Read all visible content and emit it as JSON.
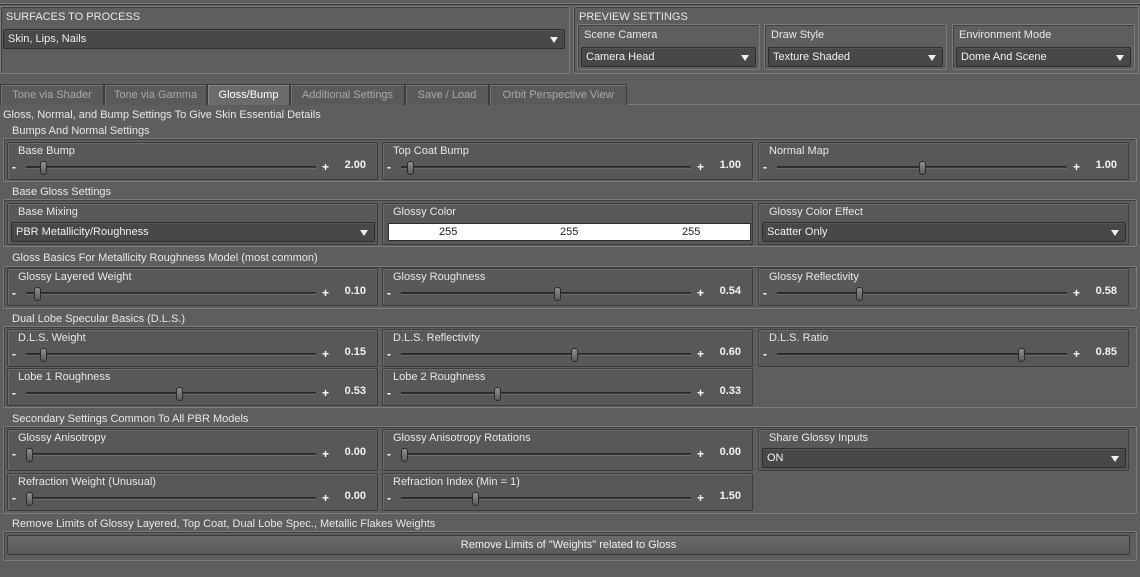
{
  "surfaces": {
    "title": "SURFACES TO PROCESS",
    "selected": "Skin, Lips, Nails"
  },
  "preview": {
    "title": "PREVIEW SETTINGS",
    "scene_camera": {
      "label": "Scene Camera",
      "value": "Camera Head"
    },
    "draw_style": {
      "label": "Draw Style",
      "value": "Texture Shaded"
    },
    "environment_mode": {
      "label": "Environment Mode",
      "value": "Dome And Scene"
    }
  },
  "tabs": [
    {
      "label": "Tone via Shader"
    },
    {
      "label": "Tone via Gamma"
    },
    {
      "label": "Gloss/Bump"
    },
    {
      "label": "Additional Settings"
    },
    {
      "label": "Save / Load"
    },
    {
      "label": "Orbit Perspective View"
    }
  ],
  "page_heading": "Gloss, Normal, and Bump Settings To Give Skin Essential Details",
  "bumps": {
    "title": "Bumps And Normal Settings",
    "base_bump": {
      "label": "Base Bump",
      "value": "2.00",
      "level": 0.05
    },
    "top_coat_bump": {
      "label": "Top Coat Bump",
      "value": "1.00",
      "level": 0.02
    },
    "normal_map": {
      "label": "Normal Map",
      "value": "1.00",
      "level": 0.5
    }
  },
  "base_gloss": {
    "title": "Base Gloss Settings",
    "base_mixing": {
      "label": "Base Mixing",
      "value": "PBR Metallicity/Roughness"
    },
    "glossy_color": {
      "label": "Glossy Color",
      "r": "255",
      "g": "255",
      "b": "255"
    },
    "glossy_color_effect": {
      "label": "Glossy Color Effect",
      "value": "Scatter Only"
    }
  },
  "gloss_basics": {
    "title": "Gloss Basics For Metallicity Roughness Model (most common)",
    "glossy_layered_weight": {
      "label": "Glossy Layered Weight",
      "value": "0.10",
      "level": 0.03
    },
    "glossy_roughness": {
      "label": "Glossy Roughness",
      "value": "0.54",
      "level": 0.54
    },
    "glossy_reflectivity": {
      "label": "Glossy Reflectivity",
      "value": "0.58",
      "level": 0.28
    }
  },
  "dls": {
    "title": "Dual Lobe Specular Basics (D.L.S.)",
    "weight": {
      "label": "D.L.S. Weight",
      "value": "0.15",
      "level": 0.05
    },
    "reflectivity": {
      "label": "D.L.S. Reflectivity",
      "value": "0.60",
      "level": 0.6
    },
    "ratio": {
      "label": "D.L.S. Ratio",
      "value": "0.85",
      "level": 0.85
    },
    "lobe1": {
      "label": "Lobe 1 Roughness",
      "value": "0.53",
      "level": 0.53
    },
    "lobe2": {
      "label": "Lobe 2 Roughness",
      "value": "0.33",
      "level": 0.33
    }
  },
  "secondary": {
    "title": "Secondary Settings Common To All PBR Models",
    "glossy_anisotropy": {
      "label": "Glossy Anisotropy",
      "value": "0.00",
      "level": 0.0
    },
    "glossy_anisotropy_rotations": {
      "label": "Glossy Anisotropy Rotations",
      "value": "0.00",
      "level": 0.0
    },
    "share_glossy_inputs": {
      "label": "Share Glossy Inputs",
      "value": "ON"
    },
    "refraction_weight": {
      "label": "Refraction Weight (Unusual)",
      "value": "0.00",
      "level": 0.0
    },
    "refraction_index": {
      "label": "Refraction Index (Min = 1)",
      "value": "1.50",
      "level": 0.25
    }
  },
  "limits": {
    "title": "Remove Limits of Glossy Layered, Top Coat, Dual Lobe Spec., Metallic Flakes Weights",
    "button_label": "Remove Limits of \"Weights\" related to Gloss"
  }
}
